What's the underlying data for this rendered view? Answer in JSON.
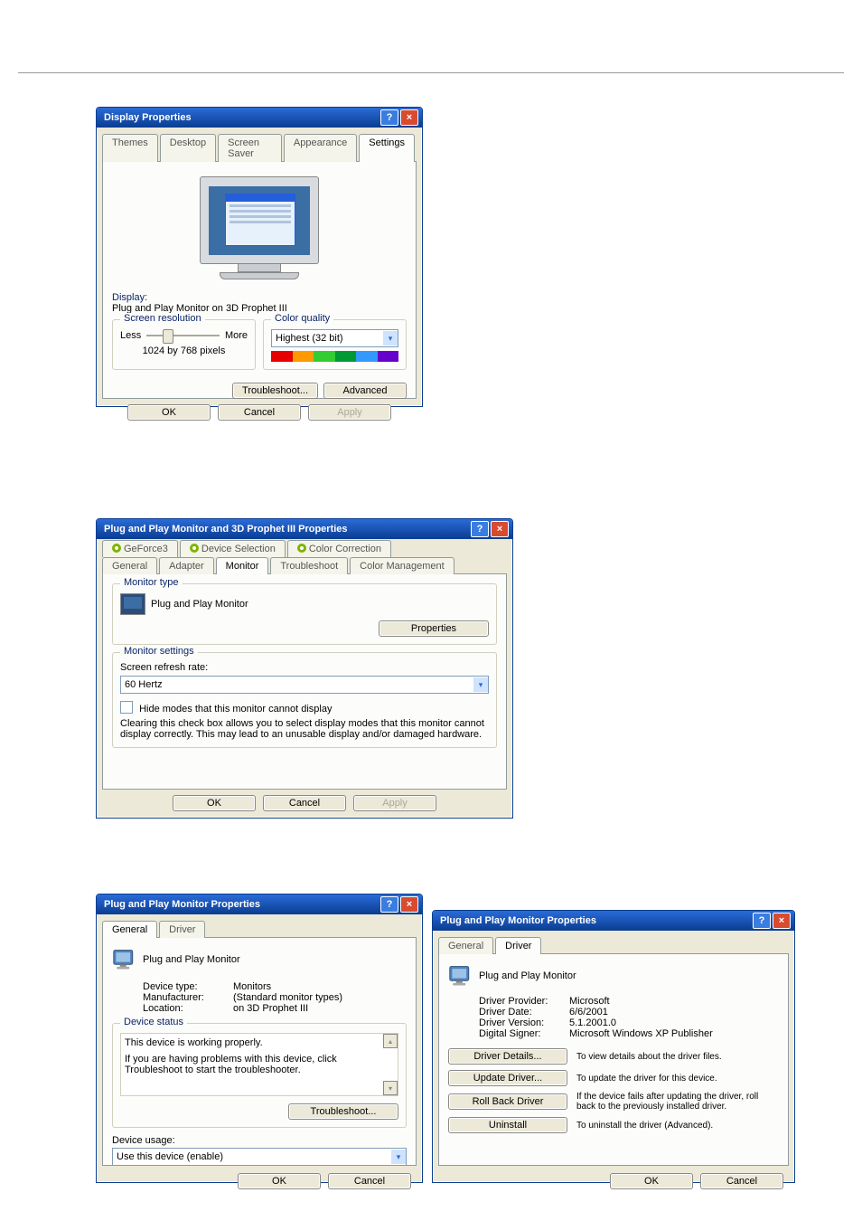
{
  "display_properties": {
    "title": "Display Properties",
    "tabs": [
      "Themes",
      "Desktop",
      "Screen Saver",
      "Appearance",
      "Settings"
    ],
    "display_label": "Display:",
    "display_value": "Plug and Play Monitor on 3D Prophet III",
    "screen_resolution_legend": "Screen resolution",
    "less": "Less",
    "more": "More",
    "resolution_value": "1024 by 768 pixels",
    "color_quality_legend": "Color quality",
    "color_quality_value": "Highest (32 bit)",
    "troubleshoot": "Troubleshoot...",
    "advanced": "Advanced",
    "ok": "OK",
    "cancel": "Cancel",
    "apply": "Apply"
  },
  "monitor_props": {
    "title": "Plug and Play Monitor and 3D Prophet III Properties",
    "tabs_row1": [
      "GeForce3",
      "Device Selection",
      "Color Correction"
    ],
    "tabs_row2": [
      "General",
      "Adapter",
      "Monitor",
      "Troubleshoot",
      "Color Management"
    ],
    "group_type_legend": "Monitor type",
    "monitor_name": "Plug and Play Monitor",
    "properties_btn": "Properties",
    "group_settings_legend": "Monitor settings",
    "refresh_label": "Screen refresh rate:",
    "refresh_value": "60 Hertz",
    "hide_modes_label": "Hide modes that this monitor cannot display",
    "hide_modes_desc": "Clearing this check box allows you to select display modes that this monitor cannot display correctly. This may lead to an unusable display and/or damaged hardware.",
    "ok": "OK",
    "cancel": "Cancel",
    "apply": "Apply"
  },
  "pnp_general": {
    "title": "Plug and Play Monitor Properties",
    "tabs": [
      "General",
      "Driver"
    ],
    "device_name": "Plug and Play Monitor",
    "type_label": "Device type:",
    "type_value": "Monitors",
    "manu_label": "Manufacturer:",
    "manu_value": "(Standard monitor types)",
    "loc_label": "Location:",
    "loc_value": "on 3D Prophet III",
    "status_legend": "Device status",
    "status_text": "This device is working properly.",
    "status_help": "If you are having problems with this device, click Troubleshoot to start the troubleshooter.",
    "troubleshoot": "Troubleshoot...",
    "usage_label": "Device usage:",
    "usage_value": "Use this device (enable)",
    "ok": "OK",
    "cancel": "Cancel"
  },
  "pnp_driver": {
    "title": "Plug and Play Monitor Properties",
    "tabs": [
      "General",
      "Driver"
    ],
    "device_name": "Plug and Play Monitor",
    "provider_label": "Driver Provider:",
    "provider_value": "Microsoft",
    "date_label": "Driver Date:",
    "date_value": "6/6/2001",
    "version_label": "Driver Version:",
    "version_value": "5.1.2001.0",
    "signer_label": "Digital Signer:",
    "signer_value": "Microsoft Windows XP Publisher",
    "details_btn": "Driver Details...",
    "details_desc": "To view details about the driver files.",
    "update_btn": "Update Driver...",
    "update_desc": "To update the driver for this device.",
    "rollback_btn": "Roll Back Driver",
    "rollback_desc": "If the device fails after updating the driver, roll back to the previously installed driver.",
    "uninstall_btn": "Uninstall",
    "uninstall_desc": "To uninstall the driver (Advanced).",
    "ok": "OK",
    "cancel": "Cancel"
  }
}
